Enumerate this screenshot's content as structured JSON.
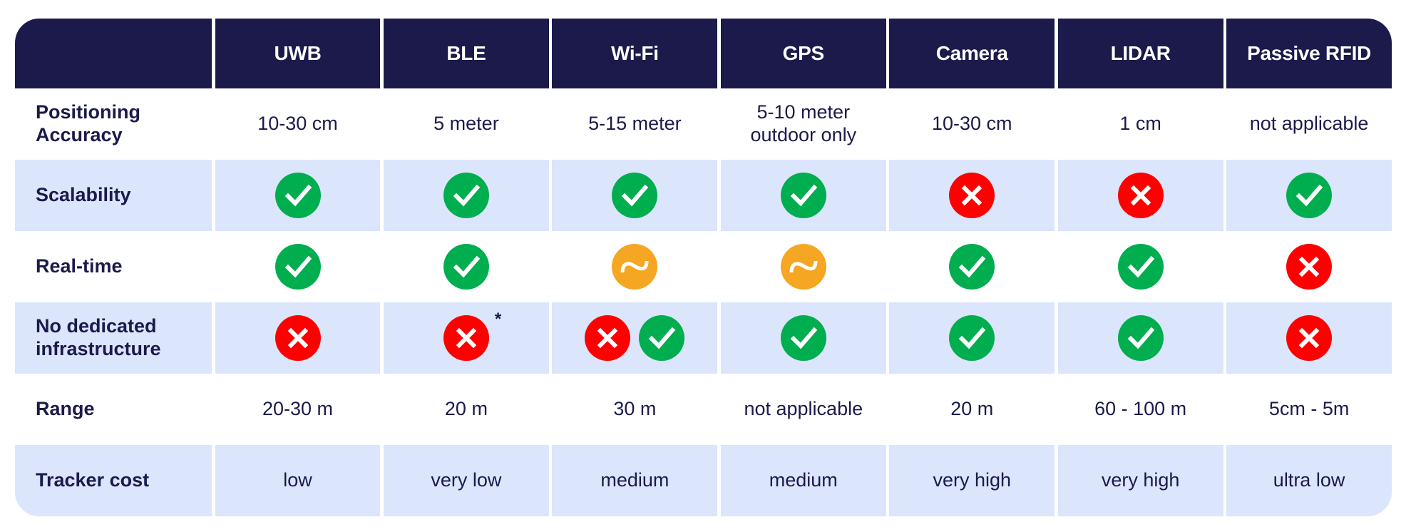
{
  "colors": {
    "header_bg": "#1b1a4b",
    "shaded_row": "#dbe5fb",
    "text": "#1b1a4b",
    "check": "#00ae4f",
    "cross": "#ff0000",
    "approx": "#f5a623"
  },
  "columns": [
    "UWB",
    "BLE",
    "Wi-Fi",
    "GPS",
    "Camera",
    "LIDAR",
    "Passive RFID"
  ],
  "rows": [
    {
      "label": "Positioning Accuracy",
      "label_lines": [
        "Positioning",
        "Accuracy"
      ],
      "type": "text",
      "shaded": false,
      "cells": [
        {
          "text": "10-30 cm"
        },
        {
          "text": "5 meter"
        },
        {
          "text": "5-15 meter"
        },
        {
          "text": "5-10 meter outdoor only",
          "lines": [
            "5-10 meter",
            "outdoor only"
          ]
        },
        {
          "text": "10-30 cm"
        },
        {
          "text": "1 cm"
        },
        {
          "text": "not applicable"
        }
      ]
    },
    {
      "label": "Scalability",
      "label_lines": [
        "Scalability"
      ],
      "type": "icons",
      "shaded": true,
      "cells": [
        {
          "icons": [
            "check-icon"
          ]
        },
        {
          "icons": [
            "check-icon"
          ]
        },
        {
          "icons": [
            "check-icon"
          ]
        },
        {
          "icons": [
            "check-icon"
          ]
        },
        {
          "icons": [
            "cross-icon"
          ]
        },
        {
          "icons": [
            "cross-icon"
          ]
        },
        {
          "icons": [
            "check-icon"
          ]
        }
      ]
    },
    {
      "label": "Real-time",
      "label_lines": [
        "Real-time"
      ],
      "type": "icons",
      "shaded": false,
      "cells": [
        {
          "icons": [
            "check-icon"
          ]
        },
        {
          "icons": [
            "check-icon"
          ]
        },
        {
          "icons": [
            "approx-icon"
          ]
        },
        {
          "icons": [
            "approx-icon"
          ]
        },
        {
          "icons": [
            "check-icon"
          ]
        },
        {
          "icons": [
            "check-icon"
          ]
        },
        {
          "icons": [
            "cross-icon"
          ]
        }
      ]
    },
    {
      "label": "No dedicated infrastructure",
      "label_lines": [
        "No dedicated",
        "infrastructure"
      ],
      "type": "icons",
      "shaded": true,
      "cells": [
        {
          "icons": [
            "cross-icon"
          ]
        },
        {
          "icons": [
            "cross-icon"
          ],
          "footnote": "*"
        },
        {
          "icons": [
            "cross-icon",
            "check-icon"
          ]
        },
        {
          "icons": [
            "check-icon"
          ]
        },
        {
          "icons": [
            "check-icon"
          ]
        },
        {
          "icons": [
            "check-icon"
          ]
        },
        {
          "icons": [
            "cross-icon"
          ]
        }
      ]
    },
    {
      "label": "Range",
      "label_lines": [
        "Range"
      ],
      "type": "text",
      "shaded": false,
      "cells": [
        {
          "text": "20-30 m"
        },
        {
          "text": "20 m"
        },
        {
          "text": "30 m"
        },
        {
          "text": "not applicable"
        },
        {
          "text": "20 m"
        },
        {
          "text": "60 - 100 m"
        },
        {
          "text": "5cm - 5m"
        }
      ]
    },
    {
      "label": "Tracker cost",
      "label_lines": [
        "Tracker cost"
      ],
      "type": "text",
      "shaded": true,
      "cells": [
        {
          "text": "low"
        },
        {
          "text": "very low"
        },
        {
          "text": "medium"
        },
        {
          "text": "medium"
        },
        {
          "text": "very high"
        },
        {
          "text": "very high"
        },
        {
          "text": "ultra low"
        }
      ]
    }
  ]
}
